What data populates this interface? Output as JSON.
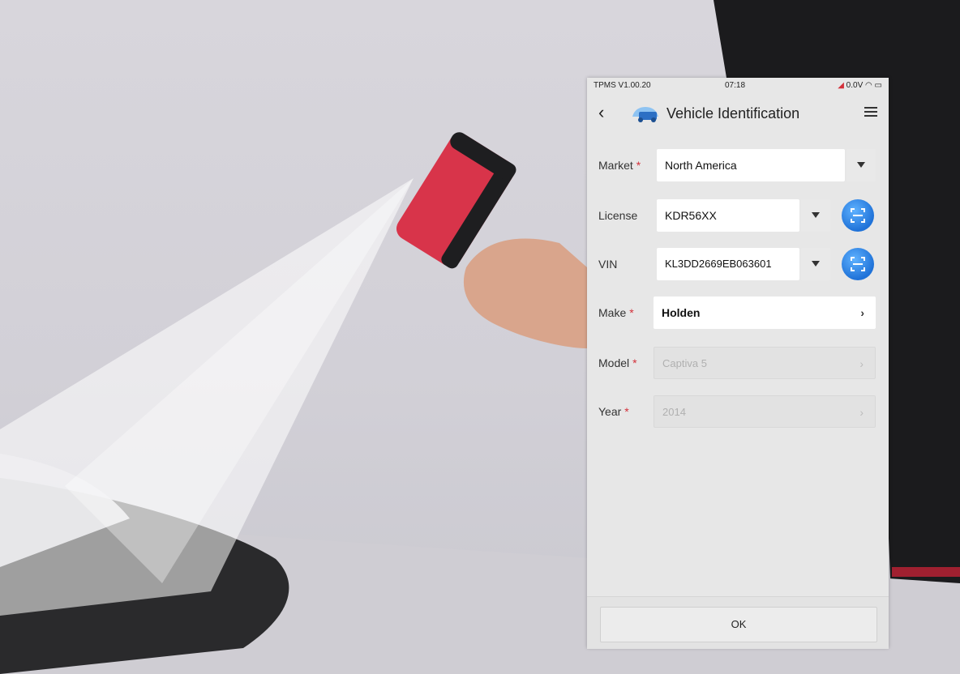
{
  "status_bar": {
    "app_version": "TPMS V1.00.20",
    "time": "07:18",
    "voltage": "0.0V"
  },
  "header": {
    "back_icon": "chevron-left-icon",
    "app_icon": "tpms-car-icon",
    "title": "Vehicle Identification",
    "menu_icon": "menu-icon"
  },
  "form": {
    "market": {
      "label": "Market",
      "required_mark": "*",
      "value": "North America"
    },
    "license": {
      "label": "License",
      "value": "KDR56XX",
      "scan_icon": "scan-icon"
    },
    "vin": {
      "label": "VIN",
      "value": "KL3DD2669EB063601",
      "scan_icon": "scan-icon"
    },
    "make": {
      "label": "Make",
      "required_mark": "*",
      "value": "Holden"
    },
    "model": {
      "label": "Model",
      "required_mark": "*",
      "value": "Captiva 5"
    },
    "year": {
      "label": "Year",
      "required_mark": "*",
      "value": "2014"
    }
  },
  "footer": {
    "ok_label": "OK"
  },
  "colors": {
    "accent_blue": "#1f72d8",
    "required_red": "#d3303a",
    "device_red": "#d8344a"
  }
}
